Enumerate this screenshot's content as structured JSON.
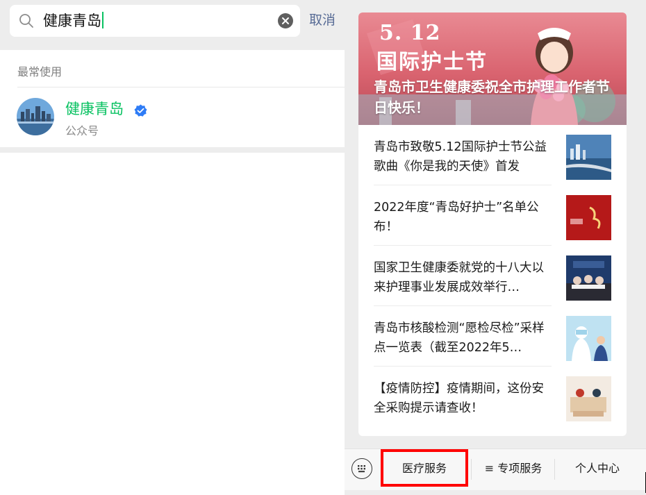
{
  "search": {
    "query": "健康青岛",
    "cancel_label": "取消"
  },
  "recent": {
    "section_title": "最常使用",
    "account": {
      "name": "健康青岛",
      "type": "公众号"
    }
  },
  "feed": {
    "banner": {
      "date_text": "5. 12",
      "event_title": "国际护士节",
      "caption": "青岛市卫生健康委祝全市护理工作者节日快乐！"
    },
    "articles": [
      {
        "title": "青岛市致敬5.12国际护士节公益歌曲《你是我的天使》首发"
      },
      {
        "title": "2022年度“青岛好护士”名单公布！"
      },
      {
        "title": "国家卫生健康委就党的十八大以来护理事业发展成效举行…"
      },
      {
        "title": "青岛市核酸检测“愿检尽检”采样点一览表（截至2022年5…"
      },
      {
        "title": "【疫情防控】疫情期间，这份安全采购提示请查收！"
      }
    ]
  },
  "menu": {
    "items": [
      {
        "label": "医疗服务",
        "highlighted": true
      },
      {
        "label": "≡ 专项服务"
      },
      {
        "label": "个人中心"
      }
    ]
  },
  "colors": {
    "accent_green": "#07c160",
    "link_blue": "#576b95",
    "highlight_red": "#ff0000",
    "banner_pink": "#e8838d"
  },
  "icons": [
    "search-icon",
    "clear-icon",
    "verified-icon",
    "keyboard-icon"
  ]
}
